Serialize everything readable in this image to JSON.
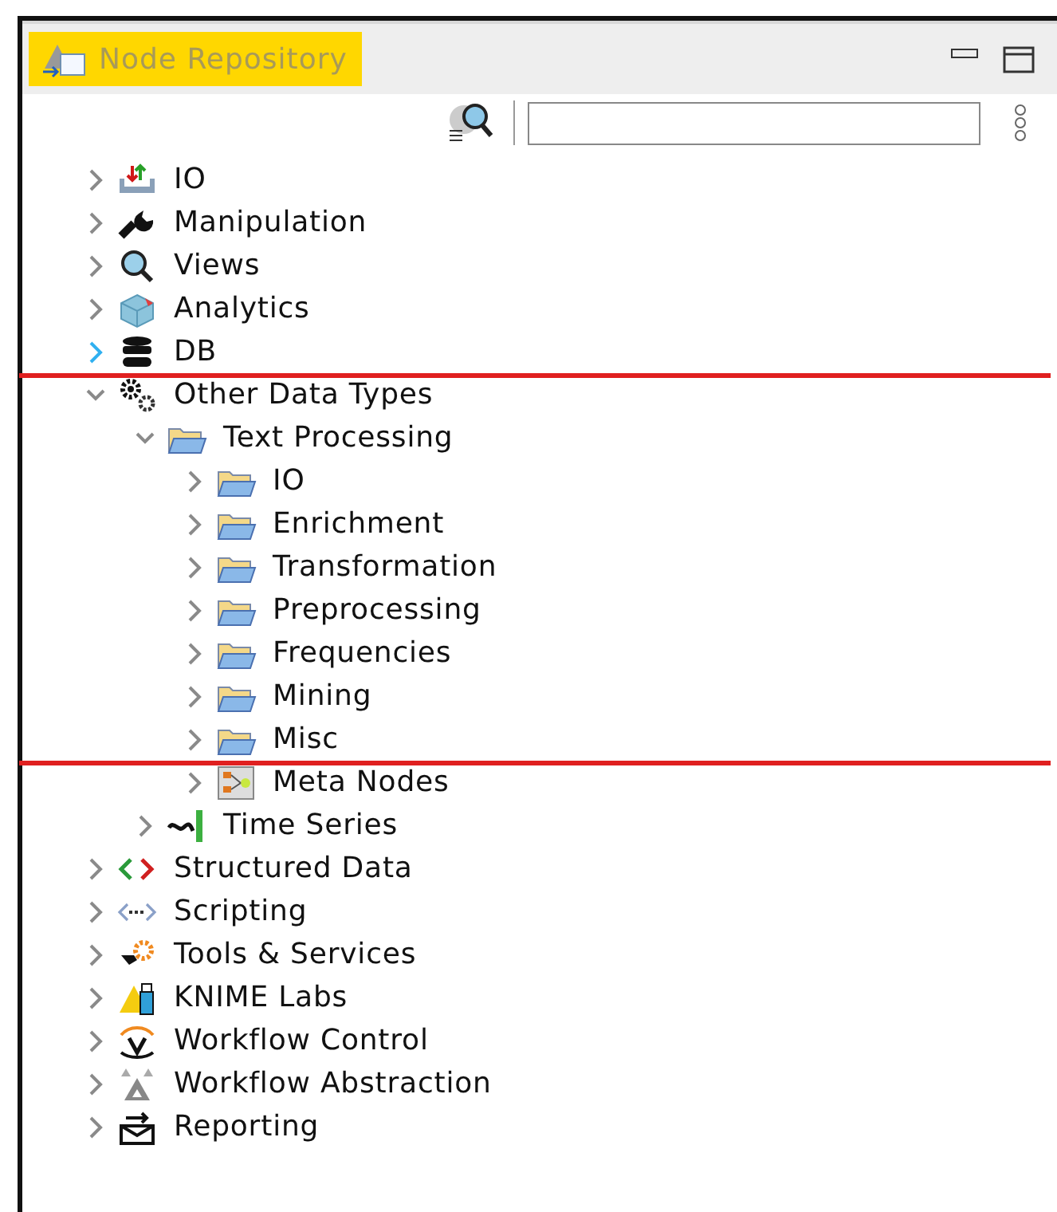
{
  "panel": {
    "title": "Node Repository"
  },
  "tree": [
    {
      "label": "IO",
      "kind": "io",
      "expanded": false,
      "hovered": false,
      "marked": false
    },
    {
      "label": "Manipulation",
      "kind": "wrench",
      "expanded": false,
      "hovered": false,
      "marked": false
    },
    {
      "label": "Views",
      "kind": "magnifier",
      "expanded": false,
      "hovered": false,
      "marked": false
    },
    {
      "label": "Analytics",
      "kind": "cube",
      "expanded": false,
      "hovered": false,
      "marked": false
    },
    {
      "label": "DB",
      "kind": "database",
      "expanded": false,
      "hovered": true,
      "marked": true
    },
    {
      "label": "Other Data Types",
      "kind": "gears",
      "expanded": true,
      "hovered": false,
      "marked": false,
      "children": [
        {
          "label": "Text Processing",
          "kind": "folder",
          "expanded": true,
          "hovered": false,
          "marked": false,
          "children": [
            {
              "label": "IO",
              "kind": "folder",
              "expanded": false,
              "hovered": false,
              "marked": false
            },
            {
              "label": "Enrichment",
              "kind": "folder",
              "expanded": false,
              "hovered": false,
              "marked": false
            },
            {
              "label": "Transformation",
              "kind": "folder",
              "expanded": false,
              "hovered": false,
              "marked": false
            },
            {
              "label": "Preprocessing",
              "kind": "folder",
              "expanded": false,
              "hovered": false,
              "marked": false
            },
            {
              "label": "Frequencies",
              "kind": "folder",
              "expanded": false,
              "hovered": false,
              "marked": false
            },
            {
              "label": "Mining",
              "kind": "folder",
              "expanded": false,
              "hovered": false,
              "marked": false
            },
            {
              "label": "Misc",
              "kind": "folder",
              "expanded": false,
              "hovered": false,
              "marked": true
            },
            {
              "label": "Meta Nodes",
              "kind": "meta",
              "expanded": false,
              "hovered": false,
              "marked": false
            }
          ]
        },
        {
          "label": "Time Series",
          "kind": "wave",
          "expanded": false,
          "hovered": false,
          "marked": false
        }
      ]
    },
    {
      "label": "Structured Data",
      "kind": "brackets",
      "expanded": false,
      "hovered": false,
      "marked": false
    },
    {
      "label": "Scripting",
      "kind": "dots",
      "expanded": false,
      "hovered": false,
      "marked": false
    },
    {
      "label": "Tools & Services",
      "kind": "tools",
      "expanded": false,
      "hovered": false,
      "marked": false
    },
    {
      "label": "KNIME Labs",
      "kind": "labs",
      "expanded": false,
      "hovered": false,
      "marked": false
    },
    {
      "label": "Workflow Control",
      "kind": "loop",
      "expanded": false,
      "hovered": false,
      "marked": false
    },
    {
      "label": "Workflow Abstraction",
      "kind": "triangles",
      "expanded": false,
      "hovered": false,
      "marked": false
    },
    {
      "label": "Reporting",
      "kind": "envelope",
      "expanded": false,
      "hovered": false,
      "marked": false
    }
  ]
}
